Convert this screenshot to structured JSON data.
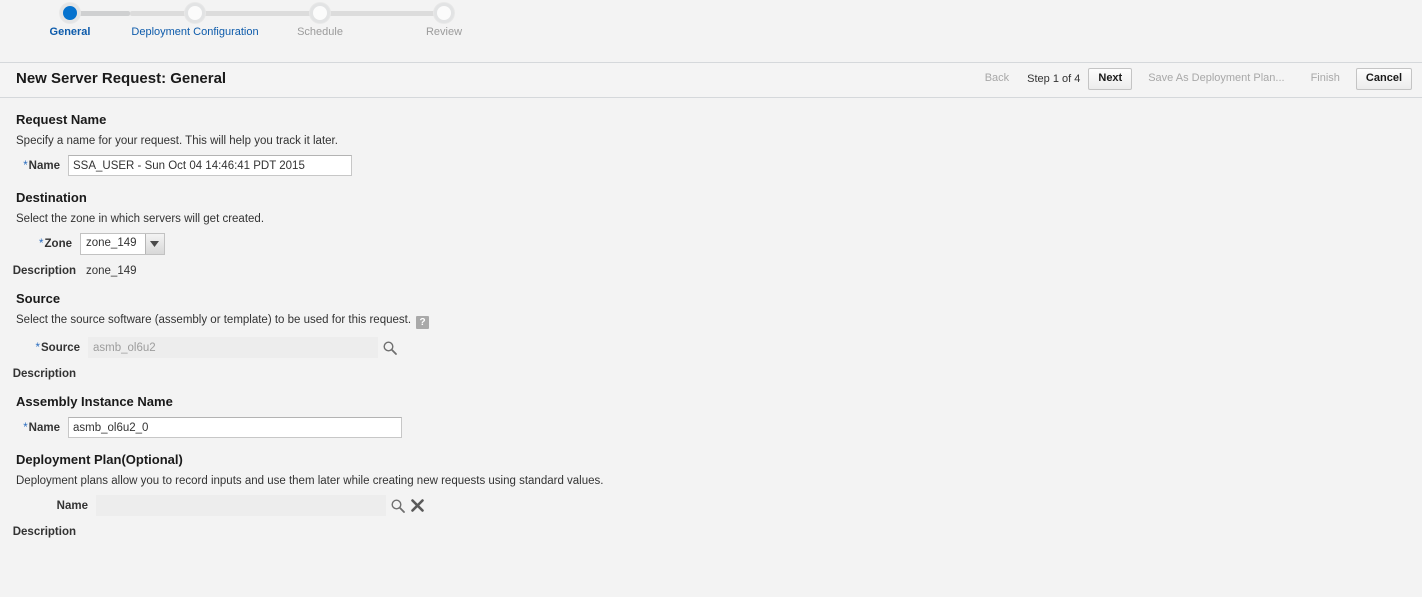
{
  "train": {
    "steps": [
      {
        "label": "General",
        "state": "current"
      },
      {
        "label": "Deployment Configuration",
        "state": "enabled"
      },
      {
        "label": "Schedule",
        "state": "disabled"
      },
      {
        "label": "Review",
        "state": "disabled"
      }
    ],
    "active_color": "#0572ce",
    "link_color": "#0d5bab",
    "disabled_color": "#9b9b9b"
  },
  "header": {
    "title": "New Server Request: General",
    "back_label": "Back",
    "step_text": "Step 1 of 4",
    "next_label": "Next",
    "save_plan_label": "Save As Deployment Plan...",
    "finish_label": "Finish",
    "cancel_label": "Cancel"
  },
  "request_name": {
    "heading": "Request Name",
    "description": "Specify a name for your request. This will help you track it later.",
    "name_label": "Name",
    "name_value": "SSA_USER - Sun Oct 04 14:46:41 PDT 2015",
    "name_placeholder": ""
  },
  "destination": {
    "heading": "Destination",
    "description": "Select the zone in which servers will get created.",
    "zone_label": "Zone",
    "zone_value": "zone_149",
    "zone_options": [
      "zone_149"
    ],
    "description_label": "Description",
    "description_value": "zone_149"
  },
  "source": {
    "heading": "Source",
    "description": "Select the source software (assembly or template) to be used for this request.",
    "help_glyph": "?",
    "source_label": "Source",
    "source_value": "asmb_ol6u2",
    "source_placeholder": "",
    "search_icon": "search-icon",
    "description_label": "Description",
    "description_value": ""
  },
  "assembly_instance": {
    "heading": "Assembly Instance Name",
    "name_label": "Name",
    "name_value": "asmb_ol6u2_0",
    "name_placeholder": ""
  },
  "deployment_plan": {
    "heading": "Deployment Plan(Optional)",
    "description": "Deployment plans allow you to record inputs and use them later while creating new requests using standard values.",
    "name_label": "Name",
    "name_value": "",
    "name_placeholder": "",
    "search_icon": "search-icon",
    "clear_icon": "close-icon",
    "description_label": "Description",
    "description_value": ""
  },
  "required_marker": "*"
}
